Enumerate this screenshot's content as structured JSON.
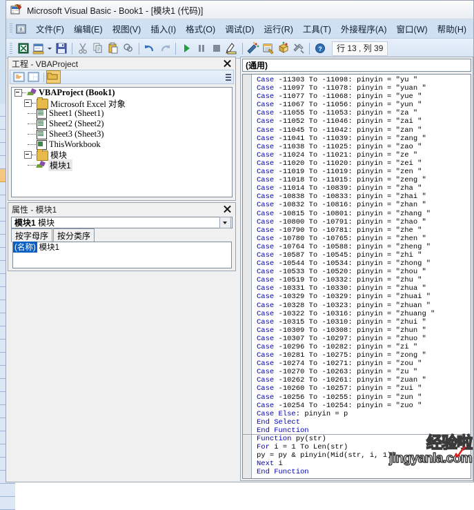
{
  "window": {
    "title": "Microsoft Visual Basic - Book1 - [模块1 (代码)]",
    "icon": "vb-app-icon"
  },
  "menubar": {
    "system_icon": "vb-doc-icon",
    "items": [
      {
        "label": "文件(F)"
      },
      {
        "label": "编辑(E)"
      },
      {
        "label": "视图(V)"
      },
      {
        "label": "插入(I)"
      },
      {
        "label": "格式(O)"
      },
      {
        "label": "调试(D)"
      },
      {
        "label": "运行(R)"
      },
      {
        "label": "工具(T)"
      },
      {
        "label": "外接程序(A)"
      },
      {
        "label": "窗口(W)"
      },
      {
        "label": "帮助(H)"
      }
    ]
  },
  "toolbar": {
    "buttons": [
      {
        "icon": "excel-view-icon"
      },
      {
        "icon": "insert-userform-icon"
      },
      {
        "icon": "save-icon"
      },
      {
        "icon": "cut-icon"
      },
      {
        "icon": "copy-icon"
      },
      {
        "icon": "paste-icon"
      },
      {
        "icon": "find-icon"
      },
      {
        "icon": "undo-icon"
      },
      {
        "icon": "redo-icon"
      },
      {
        "icon": "run-icon"
      },
      {
        "icon": "break-icon"
      },
      {
        "icon": "reset-icon"
      },
      {
        "icon": "design-mode-icon"
      },
      {
        "icon": "project-explorer-icon"
      },
      {
        "icon": "properties-window-icon"
      },
      {
        "icon": "object-browser-icon"
      },
      {
        "icon": "toolbox-icon"
      },
      {
        "icon": "help-icon"
      }
    ],
    "status": "行 13 , 列 39"
  },
  "project_panel": {
    "title": "工程 - VBAProject",
    "close_icon": "close-icon",
    "toolbar_buttons": [
      {
        "icon": "view-code-icon"
      },
      {
        "icon": "view-object-icon"
      },
      {
        "icon": "toggle-folders-icon"
      }
    ],
    "tree": [
      {
        "label": "VBAProject (Book1)",
        "icon": "vbaproject-icon",
        "depth": 0,
        "bold": true,
        "expander": true
      },
      {
        "label": "Microsoft Excel 对象",
        "icon": "folder-icon",
        "depth": 1,
        "bold": false,
        "expander": true
      },
      {
        "label": "Sheet1 (Sheet1)",
        "icon": "sheet-icon",
        "depth": 2,
        "bold": false,
        "expander": false
      },
      {
        "label": "Sheet2 (Sheet2)",
        "icon": "sheet-icon",
        "depth": 2,
        "bold": false,
        "expander": false
      },
      {
        "label": "Sheet3 (Sheet3)",
        "icon": "sheet-icon",
        "depth": 2,
        "bold": false,
        "expander": false
      },
      {
        "label": "ThisWorkbook",
        "icon": "workbook-icon",
        "depth": 2,
        "bold": false,
        "expander": false
      },
      {
        "label": "模块",
        "icon": "folder-icon",
        "depth": 1,
        "bold": false,
        "expander": true
      },
      {
        "label": "模块1",
        "icon": "module-icon",
        "depth": 2,
        "bold": false,
        "expander": false,
        "selected": true
      }
    ]
  },
  "properties_panel": {
    "title": "属性 - 模块1",
    "close_icon": "close-icon",
    "combo_name": "模块1",
    "combo_type": "模块",
    "dropdown_icon": "chevron-down-icon",
    "tabs": [
      {
        "label": "按字母序",
        "active": true
      },
      {
        "label": "按分类序",
        "active": false
      }
    ],
    "rows": [
      {
        "key": "(名称)",
        "value": "模块1"
      }
    ]
  },
  "code_window": {
    "object_combo": "(通用)",
    "lines": [
      {
        "kw": "Case",
        "rest": " -11303 To -11098: pinyin = \"yu \""
      },
      {
        "kw": "Case",
        "rest": " -11097 To -11078: pinyin = \"yuan \""
      },
      {
        "kw": "Case",
        "rest": " -11077 To -11068: pinyin = \"yue \""
      },
      {
        "kw": "Case",
        "rest": " -11067 To -11056: pinyin = \"yun \""
      },
      {
        "kw": "Case",
        "rest": " -11055 To -11053: pinyin = \"za \""
      },
      {
        "kw": "Case",
        "rest": " -11052 To -11046: pinyin = \"zai \""
      },
      {
        "kw": "Case",
        "rest": " -11045 To -11042: pinyin = \"zan \""
      },
      {
        "kw": "Case",
        "rest": " -11041 To -11039: pinyin = \"zang \""
      },
      {
        "kw": "Case",
        "rest": " -11038 To -11025: pinyin = \"zao \""
      },
      {
        "kw": "Case",
        "rest": " -11024 To -11021: pinyin = \"ze \""
      },
      {
        "kw": "Case",
        "rest": " -11020 To -11020: pinyin = \"zei \""
      },
      {
        "kw": "Case",
        "rest": " -11019 To -11019: pinyin = \"zen \""
      },
      {
        "kw": "Case",
        "rest": " -11018 To -11015: pinyin = \"zeng \""
      },
      {
        "kw": "Case",
        "rest": " -11014 To -10839: pinyin = \"zha \""
      },
      {
        "kw": "Case",
        "rest": " -10838 To -10833: pinyin = \"zhai \""
      },
      {
        "kw": "Case",
        "rest": " -10832 To -10816: pinyin = \"zhan \""
      },
      {
        "kw": "Case",
        "rest": " -10815 To -10801: pinyin = \"zhang \""
      },
      {
        "kw": "Case",
        "rest": " -10800 To -10791: pinyin = \"zhao \""
      },
      {
        "kw": "Case",
        "rest": " -10790 To -10781: pinyin = \"zhe \""
      },
      {
        "kw": "Case",
        "rest": " -10780 To -10765: pinyin = \"zhen \""
      },
      {
        "kw": "Case",
        "rest": " -10764 To -10588: pinyin = \"zheng \""
      },
      {
        "kw": "Case",
        "rest": " -10587 To -10545: pinyin = \"zhi \""
      },
      {
        "kw": "Case",
        "rest": " -10544 To -10534: pinyin = \"zhong \""
      },
      {
        "kw": "Case",
        "rest": " -10533 To -10520: pinyin = \"zhou \""
      },
      {
        "kw": "Case",
        "rest": " -10519 To -10332: pinyin = \"zhu \""
      },
      {
        "kw": "Case",
        "rest": " -10331 To -10330: pinyin = \"zhua \""
      },
      {
        "kw": "Case",
        "rest": " -10329 To -10329: pinyin = \"zhuai \""
      },
      {
        "kw": "Case",
        "rest": " -10328 To -10323: pinyin = \"zhuan \""
      },
      {
        "kw": "Case",
        "rest": " -10322 To -10316: pinyin = \"zhuang \""
      },
      {
        "kw": "Case",
        "rest": " -10315 To -10310: pinyin = \"zhui \""
      },
      {
        "kw": "Case",
        "rest": " -10309 To -10308: pinyin = \"zhun \""
      },
      {
        "kw": "Case",
        "rest": " -10307 To -10297: pinyin = \"zhuo \""
      },
      {
        "kw": "Case",
        "rest": " -10296 To -10282: pinyin = \"zi \""
      },
      {
        "kw": "Case",
        "rest": " -10281 To -10275: pinyin = \"zong \""
      },
      {
        "kw": "Case",
        "rest": " -10274 To -10271: pinyin = \"zou \""
      },
      {
        "kw": "Case",
        "rest": " -10270 To -10263: pinyin = \"zu \""
      },
      {
        "kw": "Case",
        "rest": " -10262 To -10261: pinyin = \"zuan \""
      },
      {
        "kw": "Case",
        "rest": " -10260 To -10257: pinyin = \"zui \""
      },
      {
        "kw": "Case",
        "rest": " -10256 To -10255: pinyin = \"zun \""
      },
      {
        "kw": "Case",
        "rest": " -10254 To -10254: pinyin = \"zuo \""
      },
      {
        "kw": "Case Else",
        "rest": ": pinyin = p"
      },
      {
        "kw": "End Select",
        "rest": ""
      },
      {
        "kw": "End Function",
        "rest": ""
      },
      {
        "kw": "Function",
        "rest": " py(str)",
        "sep_above": true
      },
      {
        "kw": "For",
        "rest": " i = 1 To Len(str)"
      },
      {
        "kw": "",
        "rest": "py = py & pinyin(Mid(str, i, 1))"
      },
      {
        "kw": "Next",
        "rest": " i"
      },
      {
        "kw": "End Function",
        "rest": ""
      }
    ]
  },
  "watermark": {
    "cn": "经验啦",
    "en": "jingyanla.com",
    "check": "✓",
    "check_color": "#e01b1b"
  }
}
